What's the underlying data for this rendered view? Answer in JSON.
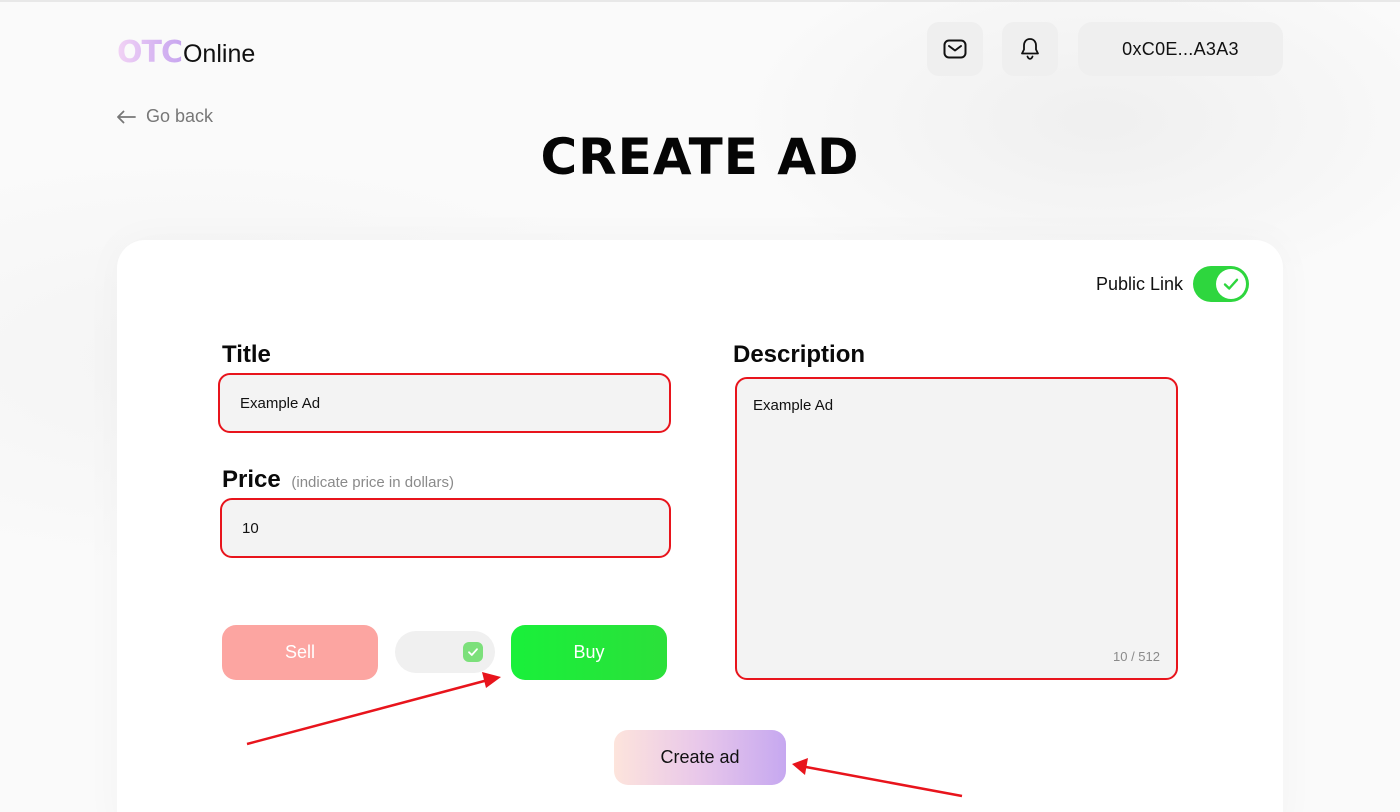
{
  "header": {
    "logo_otc": "OTC",
    "logo_online": "Online",
    "wallet_address": "0xC0E...A3A3"
  },
  "nav": {
    "go_back": "Go back"
  },
  "page": {
    "title": "CREATE AD"
  },
  "form": {
    "public_link_label": "Public Link",
    "public_link_on": true,
    "title_label": "Title",
    "title_value": "Example Ad",
    "price_label": "Price",
    "price_hint": "(indicate price in dollars)",
    "price_value": "10",
    "description_label": "Description",
    "description_value": "Example Ad",
    "description_counter": "10 / 512",
    "sell_label": "Sell",
    "buy_label": "Buy",
    "type_selected": "Buy",
    "create_label": "Create ad"
  },
  "colors": {
    "accent_green": "#2ed63e",
    "sell_red": "#fca5a1",
    "highlight_red": "#e8141c",
    "create_gradient_end": "#c6a8f0"
  },
  "icons": [
    "mail-icon",
    "bell-icon",
    "arrow-left-icon",
    "check-icon"
  ]
}
